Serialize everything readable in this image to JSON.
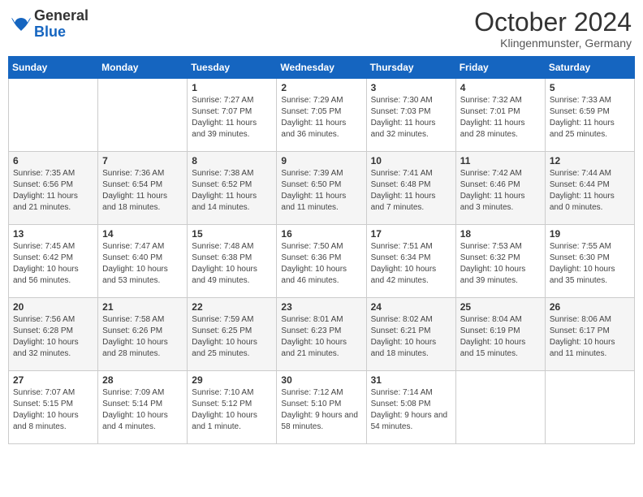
{
  "logo": {
    "general": "General",
    "blue": "Blue"
  },
  "title": {
    "month": "October 2024",
    "location": "Klingenmunster, Germany"
  },
  "weekdays": [
    "Sunday",
    "Monday",
    "Tuesday",
    "Wednesday",
    "Thursday",
    "Friday",
    "Saturday"
  ],
  "weeks": [
    [
      {
        "day": "",
        "info": ""
      },
      {
        "day": "",
        "info": ""
      },
      {
        "day": "1",
        "info": "Sunrise: 7:27 AM\nSunset: 7:07 PM\nDaylight: 11 hours and 39 minutes."
      },
      {
        "day": "2",
        "info": "Sunrise: 7:29 AM\nSunset: 7:05 PM\nDaylight: 11 hours and 36 minutes."
      },
      {
        "day": "3",
        "info": "Sunrise: 7:30 AM\nSunset: 7:03 PM\nDaylight: 11 hours and 32 minutes."
      },
      {
        "day": "4",
        "info": "Sunrise: 7:32 AM\nSunset: 7:01 PM\nDaylight: 11 hours and 28 minutes."
      },
      {
        "day": "5",
        "info": "Sunrise: 7:33 AM\nSunset: 6:59 PM\nDaylight: 11 hours and 25 minutes."
      }
    ],
    [
      {
        "day": "6",
        "info": "Sunrise: 7:35 AM\nSunset: 6:56 PM\nDaylight: 11 hours and 21 minutes."
      },
      {
        "day": "7",
        "info": "Sunrise: 7:36 AM\nSunset: 6:54 PM\nDaylight: 11 hours and 18 minutes."
      },
      {
        "day": "8",
        "info": "Sunrise: 7:38 AM\nSunset: 6:52 PM\nDaylight: 11 hours and 14 minutes."
      },
      {
        "day": "9",
        "info": "Sunrise: 7:39 AM\nSunset: 6:50 PM\nDaylight: 11 hours and 11 minutes."
      },
      {
        "day": "10",
        "info": "Sunrise: 7:41 AM\nSunset: 6:48 PM\nDaylight: 11 hours and 7 minutes."
      },
      {
        "day": "11",
        "info": "Sunrise: 7:42 AM\nSunset: 6:46 PM\nDaylight: 11 hours and 3 minutes."
      },
      {
        "day": "12",
        "info": "Sunrise: 7:44 AM\nSunset: 6:44 PM\nDaylight: 11 hours and 0 minutes."
      }
    ],
    [
      {
        "day": "13",
        "info": "Sunrise: 7:45 AM\nSunset: 6:42 PM\nDaylight: 10 hours and 56 minutes."
      },
      {
        "day": "14",
        "info": "Sunrise: 7:47 AM\nSunset: 6:40 PM\nDaylight: 10 hours and 53 minutes."
      },
      {
        "day": "15",
        "info": "Sunrise: 7:48 AM\nSunset: 6:38 PM\nDaylight: 10 hours and 49 minutes."
      },
      {
        "day": "16",
        "info": "Sunrise: 7:50 AM\nSunset: 6:36 PM\nDaylight: 10 hours and 46 minutes."
      },
      {
        "day": "17",
        "info": "Sunrise: 7:51 AM\nSunset: 6:34 PM\nDaylight: 10 hours and 42 minutes."
      },
      {
        "day": "18",
        "info": "Sunrise: 7:53 AM\nSunset: 6:32 PM\nDaylight: 10 hours and 39 minutes."
      },
      {
        "day": "19",
        "info": "Sunrise: 7:55 AM\nSunset: 6:30 PM\nDaylight: 10 hours and 35 minutes."
      }
    ],
    [
      {
        "day": "20",
        "info": "Sunrise: 7:56 AM\nSunset: 6:28 PM\nDaylight: 10 hours and 32 minutes."
      },
      {
        "day": "21",
        "info": "Sunrise: 7:58 AM\nSunset: 6:26 PM\nDaylight: 10 hours and 28 minutes."
      },
      {
        "day": "22",
        "info": "Sunrise: 7:59 AM\nSunset: 6:25 PM\nDaylight: 10 hours and 25 minutes."
      },
      {
        "day": "23",
        "info": "Sunrise: 8:01 AM\nSunset: 6:23 PM\nDaylight: 10 hours and 21 minutes."
      },
      {
        "day": "24",
        "info": "Sunrise: 8:02 AM\nSunset: 6:21 PM\nDaylight: 10 hours and 18 minutes."
      },
      {
        "day": "25",
        "info": "Sunrise: 8:04 AM\nSunset: 6:19 PM\nDaylight: 10 hours and 15 minutes."
      },
      {
        "day": "26",
        "info": "Sunrise: 8:06 AM\nSunset: 6:17 PM\nDaylight: 10 hours and 11 minutes."
      }
    ],
    [
      {
        "day": "27",
        "info": "Sunrise: 7:07 AM\nSunset: 5:15 PM\nDaylight: 10 hours and 8 minutes."
      },
      {
        "day": "28",
        "info": "Sunrise: 7:09 AM\nSunset: 5:14 PM\nDaylight: 10 hours and 4 minutes."
      },
      {
        "day": "29",
        "info": "Sunrise: 7:10 AM\nSunset: 5:12 PM\nDaylight: 10 hours and 1 minute."
      },
      {
        "day": "30",
        "info": "Sunrise: 7:12 AM\nSunset: 5:10 PM\nDaylight: 9 hours and 58 minutes."
      },
      {
        "day": "31",
        "info": "Sunrise: 7:14 AM\nSunset: 5:08 PM\nDaylight: 9 hours and 54 minutes."
      },
      {
        "day": "",
        "info": ""
      },
      {
        "day": "",
        "info": ""
      }
    ]
  ]
}
